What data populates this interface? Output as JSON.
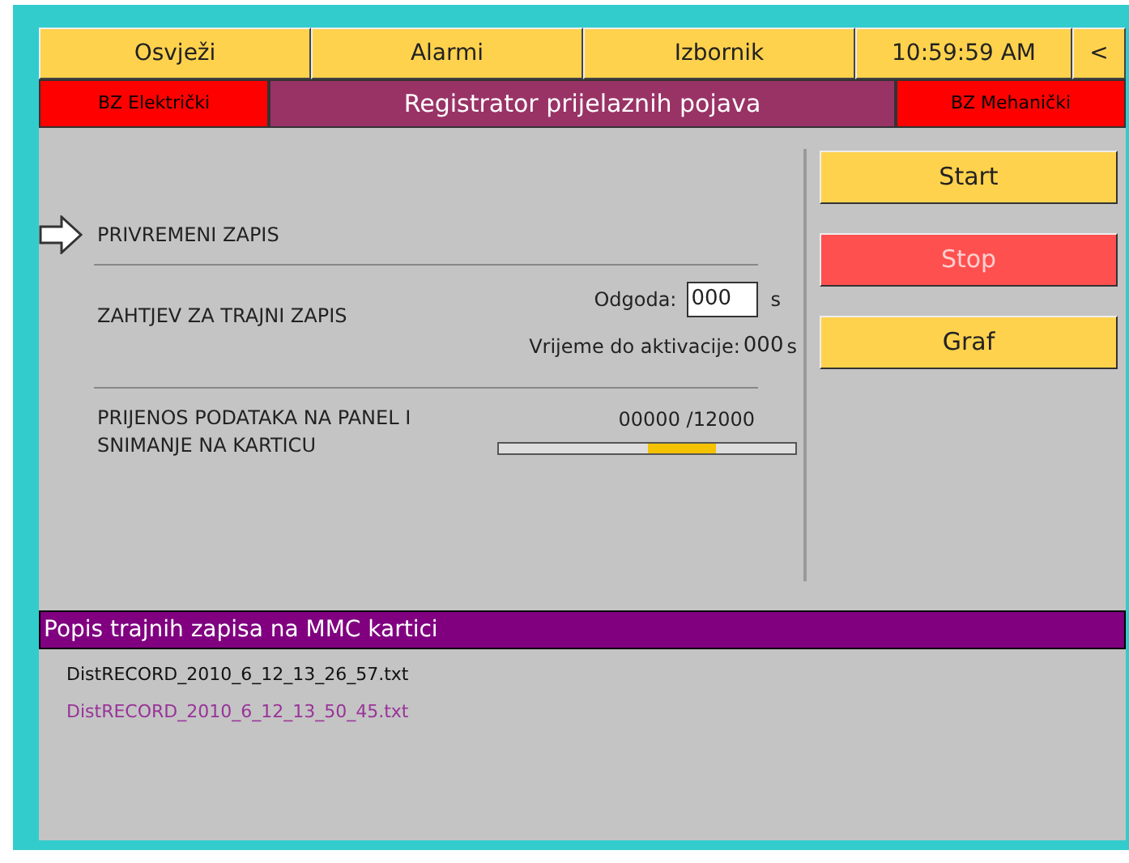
{
  "top_bar": {
    "buttons": [
      "Osvježi",
      "Alarmi",
      "Izbornik"
    ],
    "time": "10:59:59 AM",
    "back": "<"
  },
  "title_bar": {
    "left_alarm": "BZ Električki",
    "title": "Registrator prijelaznih pojava",
    "right_alarm": "BZ Mehanički"
  },
  "steps": [
    {
      "label": "PRIVREMENI ZAPIS",
      "current": true
    },
    {
      "label": "ZAHTJEV ZA TRAJNI ZAPIS",
      "current": false
    },
    {
      "label": "PRIJENOS PODATAKA NA PANEL I SNIMANJE NA KARTICU",
      "current": false
    }
  ],
  "delay": {
    "label": "Odgoda:",
    "value": "000",
    "unit": "s"
  },
  "activation": {
    "label": "Vrijeme do aktivacije:",
    "value": "000",
    "unit": "s"
  },
  "transfer": {
    "counter": "00000 /12000"
  },
  "actions": [
    {
      "label": "Start",
      "disabled": false
    },
    {
      "label": "Stop",
      "disabled": true
    },
    {
      "label": "Graf",
      "disabled": false
    }
  ],
  "records": {
    "title": "Popis trajnih zapisa na MMC kartici",
    "files": [
      {
        "name": "DistRECORD_2010_6_12_13_26_57.txt",
        "selected": false
      },
      {
        "name": "DistRECORD_2010_6_12_13_50_45.txt",
        "selected": true
      }
    ]
  }
}
